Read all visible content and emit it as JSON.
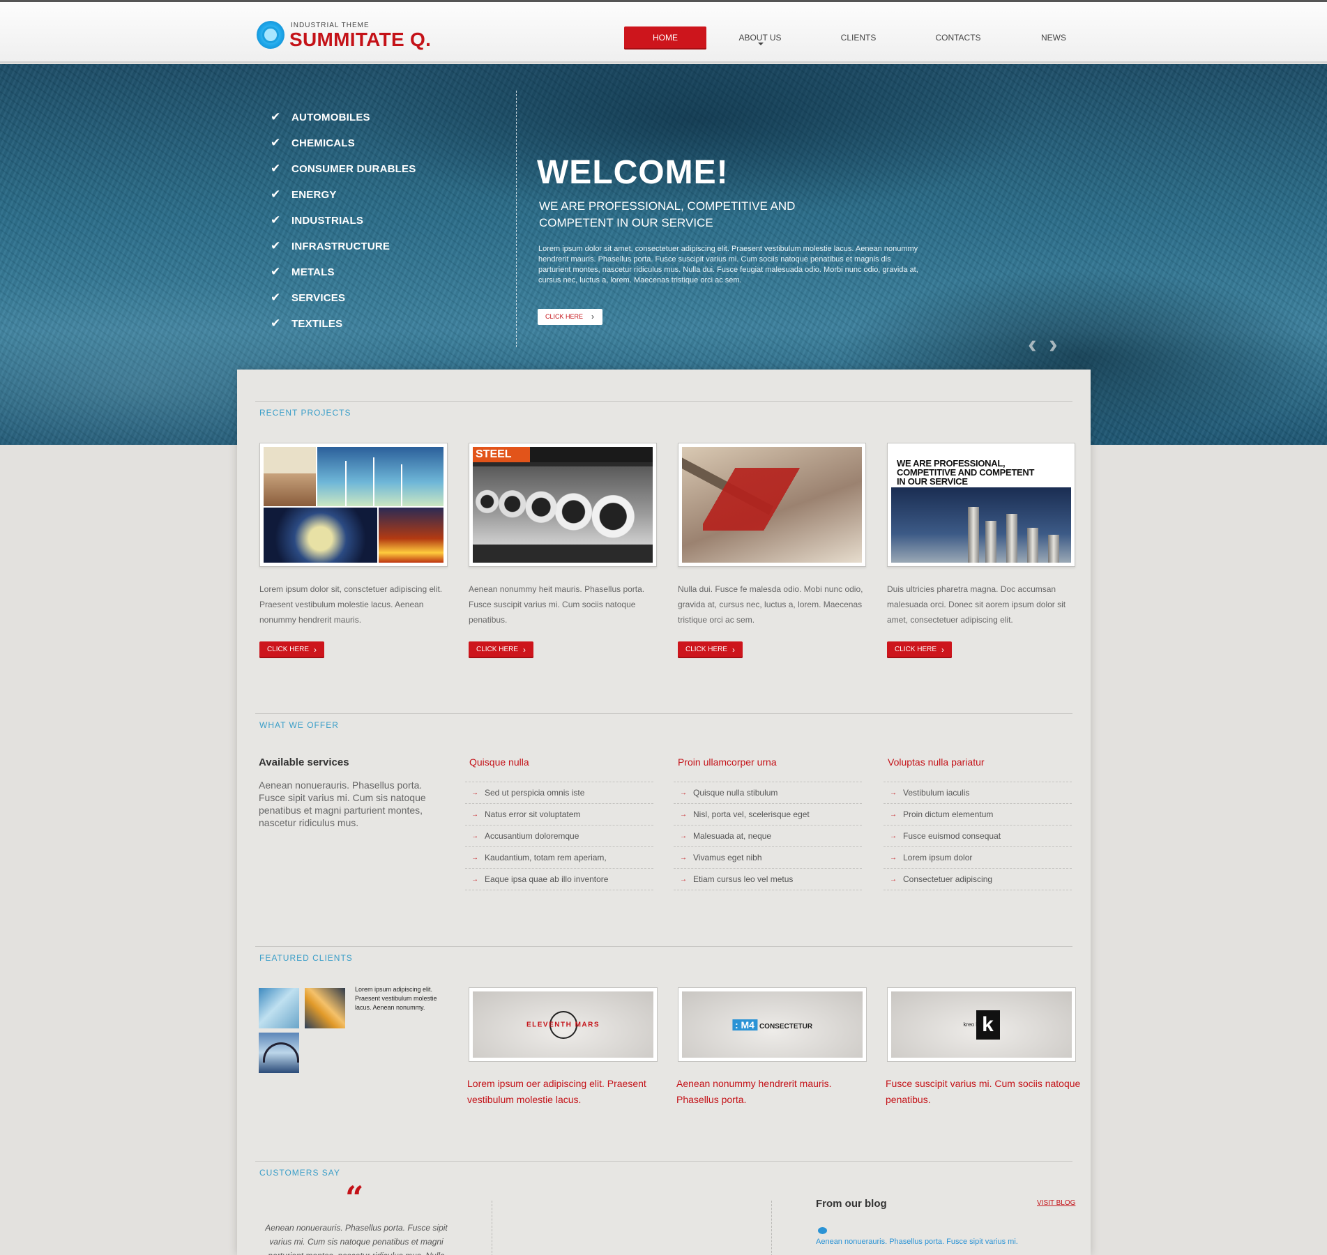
{
  "header": {
    "logo_small": "INDUSTRIAL THEME",
    "logo_big": "SUMMITATE Q.",
    "nav": [
      "HOME",
      "ABOUT US",
      "CLIENTS",
      "CONTACTS",
      "NEWS"
    ],
    "active_nav": "HOME"
  },
  "hero": {
    "categories": [
      "AUTOMOBILES",
      "CHEMICALS",
      "CONSUMER DURABLES",
      "ENERGY",
      "INDUSTRIALS",
      "INFRASTRUCTURE",
      "METALS",
      "SERVICES",
      "TEXTILES"
    ],
    "title": "WELCOME!",
    "subtitle": "WE ARE PROFESSIONAL, COMPETITIVE AND COMPETENT IN OUR SERVICE",
    "text": "Lorem ipsum dolor sit amet, consectetuer adipiscing elit. Praesent vestibulum molestie lacus. Aenean nonummy hendrerit mauris. Phasellus porta. Fusce suscipit varius mi. Cum sociis natoque penatibus et magnis dis parturient montes, nascetur ridiculus mus. Nulla dui. Fusce feugiat malesuada odio. Morbi nunc odio, gravida at, cursus nec, luctus a, lorem. Maecenas tristique orci ac sem.",
    "button": "CLICK HERE",
    "prev_icon": "‹",
    "next_icon": "›"
  },
  "recent_projects": {
    "title": "RECENT PROJECTS",
    "items": [
      {
        "text": "Lorem ipsum dolor sit, consctetuer adipiscing elit. Praesent vestibulum molestie lacus. Aenean nonummy hendrerit mauris.",
        "button": "CLICK HERE"
      },
      {
        "text": "Aenean nonummy heit mauris. Phasellus porta. Fusce suscipit varius mi. Cum sociis natoque penatibus.",
        "button": "CLICK HERE",
        "image_label": "STEEL"
      },
      {
        "text": "Nulla dui. Fusce fe malesda odio. Mobi nunc odio, gravida at, cursus nec, luctus a, lorem. Maecenas tristique orci ac sem.",
        "button": "CLICK HERE"
      },
      {
        "text": "Duis ultricies pharetra magna. Doc accumsan malesuada orci. Donec sit aorem ipsum dolor sit amet, consectetuer adipiscing elit.",
        "button": "CLICK HERE",
        "image_label": "WE ARE PROFESSIONAL, COMPETITIVE AND COMPETENT IN OUR SERVICE"
      }
    ]
  },
  "offer": {
    "title": "WHAT WE OFFER",
    "available_title": "Available services",
    "available_text": "Aenean nonuerauris. Phasellus porta. Fusce sipit varius mi. Cum sis natoque penatibus et magni parturient montes, nascetur ridiculus mus.",
    "columns": [
      {
        "heading": "Quisque nulla",
        "items": [
          "Sed ut perspicia omnis iste",
          "Natus error sit voluptatem",
          "Accusantium doloremque",
          "Kaudantium, totam rem aperiam,",
          "Eaque ipsa quae ab illo inventore"
        ]
      },
      {
        "heading": "Proin ullamcorper urna",
        "items": [
          "Quisque nulla stibulum",
          "Nisl, porta vel, scelerisque eget",
          "Malesuada at, neque",
          "Vivamus eget nibh",
          "Etiam cursus leo vel metus"
        ]
      },
      {
        "heading": "Voluptas nulla pariatur",
        "items": [
          "Vestibulum iaculis",
          "Proin dictum elementum",
          "Fusce euismod consequat",
          "Lorem ipsum dolor",
          "Consectetuer adipiscing"
        ]
      }
    ]
  },
  "clients": {
    "title": "FEATURED CLIENTS",
    "small_text": "Lorem ipsum adipiscing elit. Praesent vestibulum molestie lacus. Aenean nonummy.",
    "logos": [
      {
        "name": "ELEVENTH MARS"
      },
      {
        "name_badge": ": M4",
        "name": "CONSECTETUR"
      },
      {
        "name_small": "kreo kool katz",
        "name_letter": "k"
      }
    ],
    "captions": [
      "Lorem ipsum oer adipiscing elit. Praesent vestibulum molestie lacus.",
      "Aenean nonummy hendrerit mauris. Phasellus porta.",
      "Fusce suscipit varius mi. Cum sociis natoque penatibus."
    ]
  },
  "customers": {
    "title": "CUSTOMERS SAY",
    "quote_mark": "“",
    "quote": "Aenean nonuerauris. Phasellus porta. Fusce sipit varius mi. Cum sis natoque penatibus et magni parturient montes, nascetur ridiculus mus. Nulla",
    "blog_title": "From our blog",
    "visit_blog": "VISIT BLOG",
    "blog_text": "Aenean nonuerauris. Phasellus porta. Fusce sipit varius mi."
  }
}
